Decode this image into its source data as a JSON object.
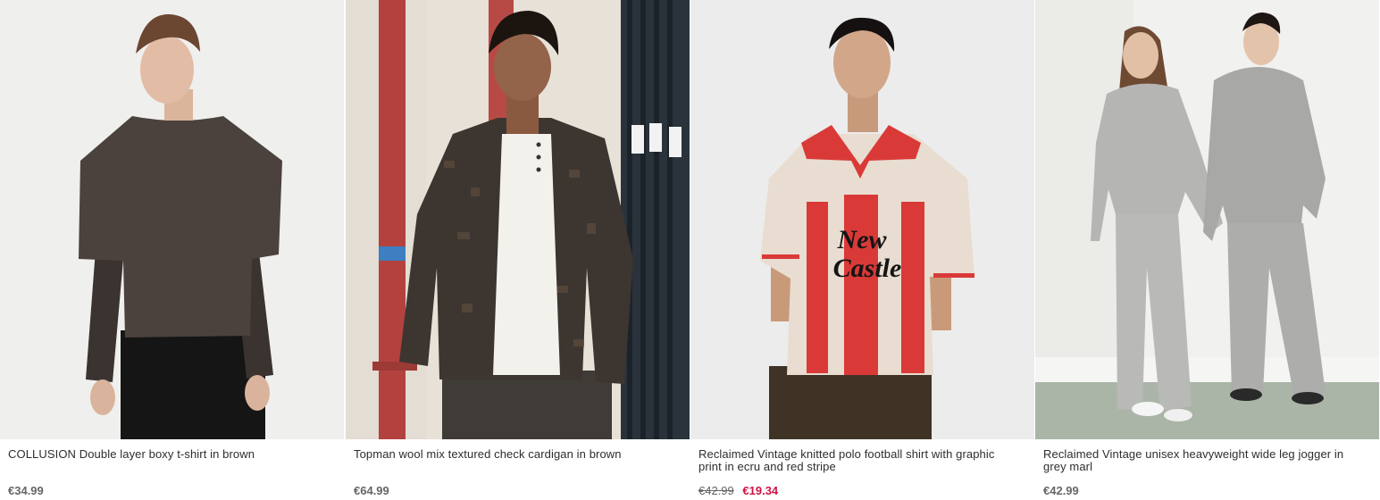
{
  "products": [
    {
      "title": "COLLUSION Double layer boxy t-shirt in brown",
      "price": "€34.99",
      "image": "model-in-brown-double-layer-tshirt"
    },
    {
      "title": "Topman wool mix textured check cardigan in brown",
      "price": "€64.99",
      "image": "model-in-check-cardigan"
    },
    {
      "title": "Reclaimed Vintage knitted polo football shirt with graphic print in ecru and red stripe",
      "original_price": "€42.99",
      "sale_price": "€19.34",
      "graphic_text": "New Castle",
      "image": "model-in-striped-polo"
    },
    {
      "title": "Reclaimed Vintage unisex heavyweight wide leg jogger in grey marl",
      "price": "€42.99",
      "image": "two-models-in-grey-joggers"
    }
  ],
  "colors": {
    "sale": "#d01345",
    "price": "#666666",
    "text": "#2d2d2d"
  }
}
